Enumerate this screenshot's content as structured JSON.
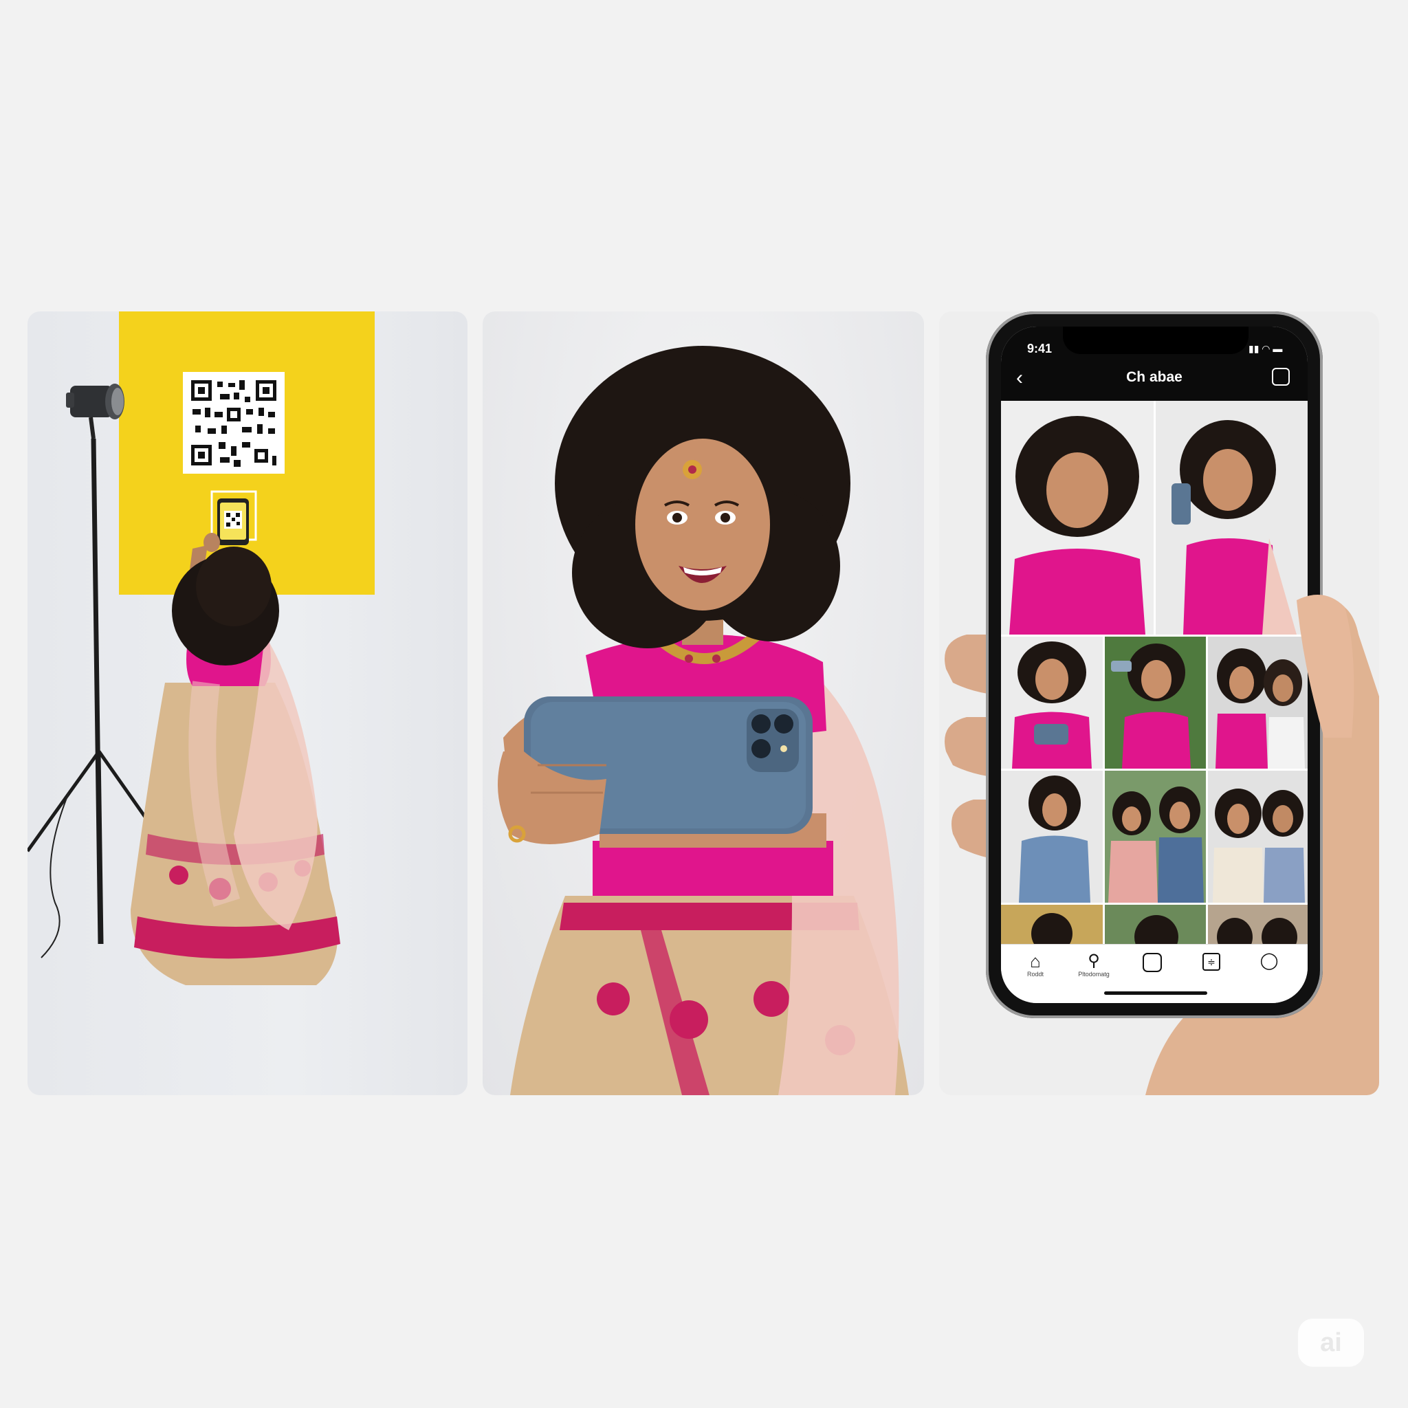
{
  "phone": {
    "status_time": "9:41",
    "title": "Ch abae",
    "nav_items": [
      {
        "icon": "home-icon",
        "label": "Roddt"
      },
      {
        "icon": "search-icon",
        "label": "Pltodomatg"
      },
      {
        "icon": "camera-icon",
        "label": ""
      },
      {
        "icon": "adjust-icon",
        "label": ""
      },
      {
        "icon": "profile-icon",
        "label": ""
      }
    ]
  },
  "colors": {
    "backdrop_yellow": "#f4d21c",
    "blouse_pink": "#e0158c",
    "phone_case_blue": "#5a7693",
    "dupatta_peach": "#f1c9bf",
    "lehenga_gold": "#d8b88e"
  },
  "watermark": {
    "text": "ai"
  }
}
